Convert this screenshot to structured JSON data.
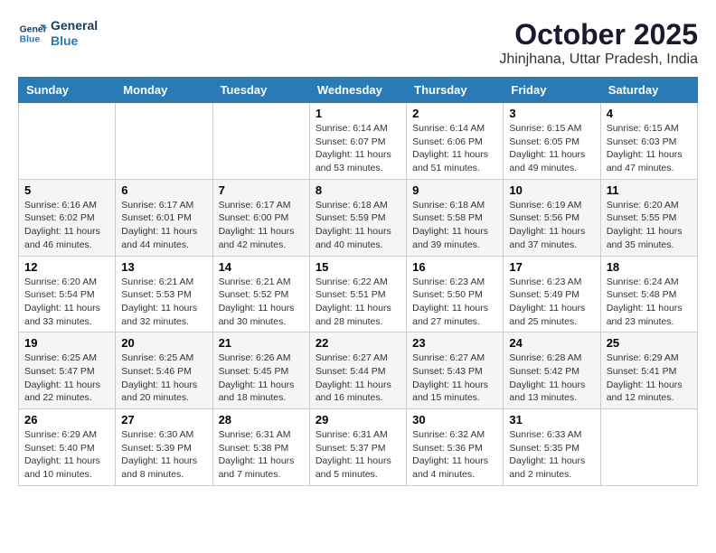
{
  "header": {
    "logo_line1": "General",
    "logo_line2": "Blue",
    "month": "October 2025",
    "location": "Jhinjhana, Uttar Pradesh, India"
  },
  "days_of_week": [
    "Sunday",
    "Monday",
    "Tuesday",
    "Wednesday",
    "Thursday",
    "Friday",
    "Saturday"
  ],
  "weeks": [
    [
      {
        "day": "",
        "info": ""
      },
      {
        "day": "",
        "info": ""
      },
      {
        "day": "",
        "info": ""
      },
      {
        "day": "1",
        "sunrise": "Sunrise: 6:14 AM",
        "sunset": "Sunset: 6:07 PM",
        "daylight": "Daylight: 11 hours and 53 minutes."
      },
      {
        "day": "2",
        "sunrise": "Sunrise: 6:14 AM",
        "sunset": "Sunset: 6:06 PM",
        "daylight": "Daylight: 11 hours and 51 minutes."
      },
      {
        "day": "3",
        "sunrise": "Sunrise: 6:15 AM",
        "sunset": "Sunset: 6:05 PM",
        "daylight": "Daylight: 11 hours and 49 minutes."
      },
      {
        "day": "4",
        "sunrise": "Sunrise: 6:15 AM",
        "sunset": "Sunset: 6:03 PM",
        "daylight": "Daylight: 11 hours and 47 minutes."
      }
    ],
    [
      {
        "day": "5",
        "sunrise": "Sunrise: 6:16 AM",
        "sunset": "Sunset: 6:02 PM",
        "daylight": "Daylight: 11 hours and 46 minutes."
      },
      {
        "day": "6",
        "sunrise": "Sunrise: 6:17 AM",
        "sunset": "Sunset: 6:01 PM",
        "daylight": "Daylight: 11 hours and 44 minutes."
      },
      {
        "day": "7",
        "sunrise": "Sunrise: 6:17 AM",
        "sunset": "Sunset: 6:00 PM",
        "daylight": "Daylight: 11 hours and 42 minutes."
      },
      {
        "day": "8",
        "sunrise": "Sunrise: 6:18 AM",
        "sunset": "Sunset: 5:59 PM",
        "daylight": "Daylight: 11 hours and 40 minutes."
      },
      {
        "day": "9",
        "sunrise": "Sunrise: 6:18 AM",
        "sunset": "Sunset: 5:58 PM",
        "daylight": "Daylight: 11 hours and 39 minutes."
      },
      {
        "day": "10",
        "sunrise": "Sunrise: 6:19 AM",
        "sunset": "Sunset: 5:56 PM",
        "daylight": "Daylight: 11 hours and 37 minutes."
      },
      {
        "day": "11",
        "sunrise": "Sunrise: 6:20 AM",
        "sunset": "Sunset: 5:55 PM",
        "daylight": "Daylight: 11 hours and 35 minutes."
      }
    ],
    [
      {
        "day": "12",
        "sunrise": "Sunrise: 6:20 AM",
        "sunset": "Sunset: 5:54 PM",
        "daylight": "Daylight: 11 hours and 33 minutes."
      },
      {
        "day": "13",
        "sunrise": "Sunrise: 6:21 AM",
        "sunset": "Sunset: 5:53 PM",
        "daylight": "Daylight: 11 hours and 32 minutes."
      },
      {
        "day": "14",
        "sunrise": "Sunrise: 6:21 AM",
        "sunset": "Sunset: 5:52 PM",
        "daylight": "Daylight: 11 hours and 30 minutes."
      },
      {
        "day": "15",
        "sunrise": "Sunrise: 6:22 AM",
        "sunset": "Sunset: 5:51 PM",
        "daylight": "Daylight: 11 hours and 28 minutes."
      },
      {
        "day": "16",
        "sunrise": "Sunrise: 6:23 AM",
        "sunset": "Sunset: 5:50 PM",
        "daylight": "Daylight: 11 hours and 27 minutes."
      },
      {
        "day": "17",
        "sunrise": "Sunrise: 6:23 AM",
        "sunset": "Sunset: 5:49 PM",
        "daylight": "Daylight: 11 hours and 25 minutes."
      },
      {
        "day": "18",
        "sunrise": "Sunrise: 6:24 AM",
        "sunset": "Sunset: 5:48 PM",
        "daylight": "Daylight: 11 hours and 23 minutes."
      }
    ],
    [
      {
        "day": "19",
        "sunrise": "Sunrise: 6:25 AM",
        "sunset": "Sunset: 5:47 PM",
        "daylight": "Daylight: 11 hours and 22 minutes."
      },
      {
        "day": "20",
        "sunrise": "Sunrise: 6:25 AM",
        "sunset": "Sunset: 5:46 PM",
        "daylight": "Daylight: 11 hours and 20 minutes."
      },
      {
        "day": "21",
        "sunrise": "Sunrise: 6:26 AM",
        "sunset": "Sunset: 5:45 PM",
        "daylight": "Daylight: 11 hours and 18 minutes."
      },
      {
        "day": "22",
        "sunrise": "Sunrise: 6:27 AM",
        "sunset": "Sunset: 5:44 PM",
        "daylight": "Daylight: 11 hours and 16 minutes."
      },
      {
        "day": "23",
        "sunrise": "Sunrise: 6:27 AM",
        "sunset": "Sunset: 5:43 PM",
        "daylight": "Daylight: 11 hours and 15 minutes."
      },
      {
        "day": "24",
        "sunrise": "Sunrise: 6:28 AM",
        "sunset": "Sunset: 5:42 PM",
        "daylight": "Daylight: 11 hours and 13 minutes."
      },
      {
        "day": "25",
        "sunrise": "Sunrise: 6:29 AM",
        "sunset": "Sunset: 5:41 PM",
        "daylight": "Daylight: 11 hours and 12 minutes."
      }
    ],
    [
      {
        "day": "26",
        "sunrise": "Sunrise: 6:29 AM",
        "sunset": "Sunset: 5:40 PM",
        "daylight": "Daylight: 11 hours and 10 minutes."
      },
      {
        "day": "27",
        "sunrise": "Sunrise: 6:30 AM",
        "sunset": "Sunset: 5:39 PM",
        "daylight": "Daylight: 11 hours and 8 minutes."
      },
      {
        "day": "28",
        "sunrise": "Sunrise: 6:31 AM",
        "sunset": "Sunset: 5:38 PM",
        "daylight": "Daylight: 11 hours and 7 minutes."
      },
      {
        "day": "29",
        "sunrise": "Sunrise: 6:31 AM",
        "sunset": "Sunset: 5:37 PM",
        "daylight": "Daylight: 11 hours and 5 minutes."
      },
      {
        "day": "30",
        "sunrise": "Sunrise: 6:32 AM",
        "sunset": "Sunset: 5:36 PM",
        "daylight": "Daylight: 11 hours and 4 minutes."
      },
      {
        "day": "31",
        "sunrise": "Sunrise: 6:33 AM",
        "sunset": "Sunset: 5:35 PM",
        "daylight": "Daylight: 11 hours and 2 minutes."
      },
      {
        "day": "",
        "info": ""
      }
    ]
  ]
}
